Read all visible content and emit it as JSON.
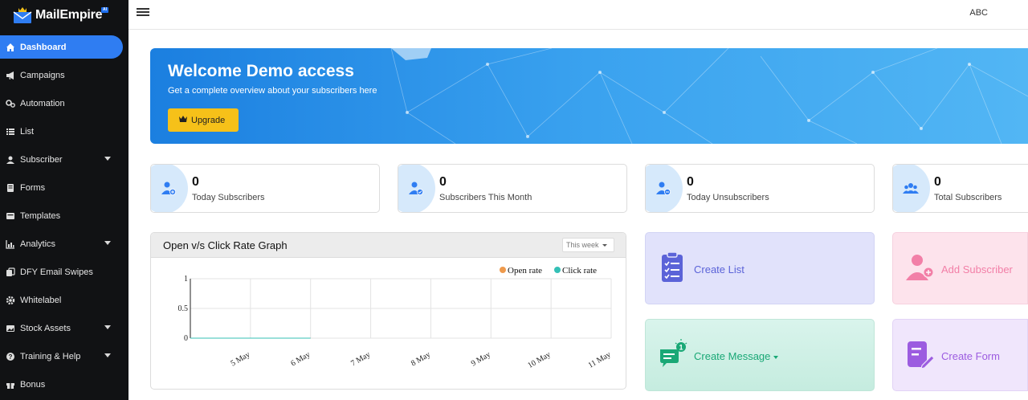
{
  "app": {
    "logo_text": "MailEmpire",
    "logo_badge": "AI"
  },
  "sidebar": {
    "items": [
      {
        "label": "Dashboard",
        "icon": "home-icon"
      },
      {
        "label": "Campaigns",
        "icon": "megaphone-icon"
      },
      {
        "label": "Automation",
        "icon": "gears-icon"
      },
      {
        "label": "List",
        "icon": "list-icon"
      },
      {
        "label": "Subscriber",
        "icon": "user-icon",
        "has_submenu": true
      },
      {
        "label": "Forms",
        "icon": "form-icon"
      },
      {
        "label": "Templates",
        "icon": "template-icon"
      },
      {
        "label": "Analytics",
        "icon": "bar-chart-icon",
        "has_submenu": true
      },
      {
        "label": "DFY Email Swipes",
        "icon": "swipe-icon"
      },
      {
        "label": "Whitelabel",
        "icon": "gear-icon"
      },
      {
        "label": "Stock Assets",
        "icon": "stock-icon",
        "has_submenu": true
      },
      {
        "label": "Training & Help",
        "icon": "help-icon",
        "has_submenu": true
      },
      {
        "label": "Bonus",
        "icon": "gift-icon"
      }
    ]
  },
  "topbar": {
    "user": "ABC"
  },
  "banner": {
    "title": "Welcome Demo access",
    "subtitle": "Get a complete overview about your subscribers here",
    "upgrade_label": "Upgrade"
  },
  "stats": [
    {
      "value": "0",
      "label": "Today Subscribers",
      "icon": "user-plus-icon"
    },
    {
      "value": "0",
      "label": "Subscribers This Month",
      "icon": "user-check-icon"
    },
    {
      "value": "0",
      "label": "Today Unsubscribers",
      "icon": "user-minus-icon"
    },
    {
      "value": "0",
      "label": "Total Subscribers",
      "icon": "users-icon"
    }
  ],
  "graph": {
    "title": "Open v/s Click Rate Graph",
    "range_select": "This week"
  },
  "chart_data": {
    "type": "line",
    "x": [
      "5 May",
      "6 May",
      "7 May",
      "8 May",
      "9 May",
      "10 May",
      "11 May"
    ],
    "series": [
      {
        "name": "Open rate",
        "color": "#ee9a4d",
        "values": [
          0,
          0,
          0
        ]
      },
      {
        "name": "Click rate",
        "color": "#34c0b6",
        "values": [
          0,
          0,
          0
        ]
      }
    ],
    "yticks": [
      "0",
      "0.5",
      "1"
    ],
    "ylim": [
      0,
      1
    ],
    "grid": true,
    "legend": "top-right"
  },
  "actions": {
    "create_list": "Create List",
    "add_subscriber": "Add Subscriber",
    "create_message": "Create Message",
    "create_form": "Create Form"
  },
  "colors": {
    "accent": "#2f7df2",
    "sidebar_bg": "#111214",
    "upgrade": "#f6c119"
  }
}
